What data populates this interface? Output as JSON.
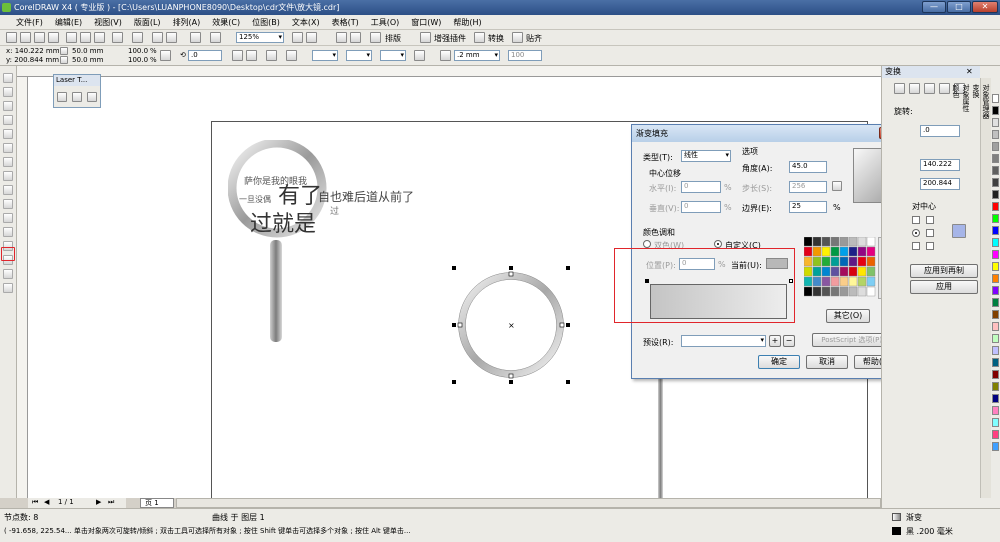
{
  "window": {
    "title": "CorelDRAW X4 ( 专业版 ) - [C:\\Users\\LUANPHONE8090\\Desktop\\cdr文件\\放大镜.cdr]"
  },
  "menu": [
    "文件(F)",
    "编辑(E)",
    "视图(V)",
    "版面(L)",
    "排列(A)",
    "效果(C)",
    "位图(B)",
    "文本(X)",
    "表格(T)",
    "工具(O)",
    "窗口(W)",
    "帮助(H)"
  ],
  "toolbar": {
    "zoom": "125%",
    "typeset": "排版",
    "plugins": "增强插件",
    "convert": "转换",
    "paste": "贴齐"
  },
  "propbar": {
    "x": "x: 140.222 mm",
    "y": "y: 200.844 mm",
    "w": "50.0 mm",
    "h": "50.0 mm",
    "sx": "100.0",
    "sy": "100.0",
    "pct": "%",
    "angle": ".0",
    "outline": ".2 mm",
    "last": "100"
  },
  "laser_panel": {
    "title": "Laser T..."
  },
  "artwork": {
    "line1": "萨你是我的眼我",
    "line2a": "一旦没偶",
    "big1": "有了",
    "tail": "自也难后道从前了",
    "big2": "过就是",
    "tail2": "过"
  },
  "dialog": {
    "title": "渐变填充",
    "type_label": "类型(T):",
    "type_value": "线性",
    "center_offset": "中心位移",
    "h_label": "水平(I):",
    "h_value": "0",
    "v_label": "垂直(V):",
    "v_value": "0",
    "pct": "%",
    "options": "选项",
    "angle_label": "角度(A):",
    "angle_value": "45.0",
    "steps_label": "步长(S):",
    "steps_value": "256",
    "edge_label": "边界(E):",
    "edge_value": "25",
    "color_blend": "颜色调和",
    "two_color": "双色(W)",
    "custom": "自定义(C)",
    "pos_label": "位置(P):",
    "pos_value": "0",
    "current_label": "当前(U):",
    "other_btn": "其它(O)",
    "preset_label": "预设(R):",
    "postscript_btn": "PostScript 选项(P)...",
    "ok": "确定",
    "cancel": "取消",
    "help": "帮助(H)"
  },
  "rightpanel": {
    "title": "变换",
    "rotate": "旋转:",
    "angle": ".0",
    "cx": "140.222",
    "cy": "200.844",
    "center": "对中心",
    "apply_copy": "应用到再制",
    "apply": "应用",
    "side_tabs": [
      "对象管理器",
      "变换",
      "对象属性",
      "颜色"
    ]
  },
  "pages": {
    "count": "1 / 1",
    "tab": "页 1"
  },
  "status": {
    "nodes": "节点数: 8",
    "object": "曲线 于 图层 1",
    "fill": "渐变",
    "outline": "黑 .200 毫米",
    "hint": "( -91.658, 225.54... 单击对象两次可旋转/倾斜 ; 双击工具可选择所有对象 ; 按住 Shift 键单击可选择多个对象 ; 按住 Alt 键单击..."
  },
  "colors": {
    "accent_red": "#e0252b",
    "title_blue": "#2c4f86"
  }
}
